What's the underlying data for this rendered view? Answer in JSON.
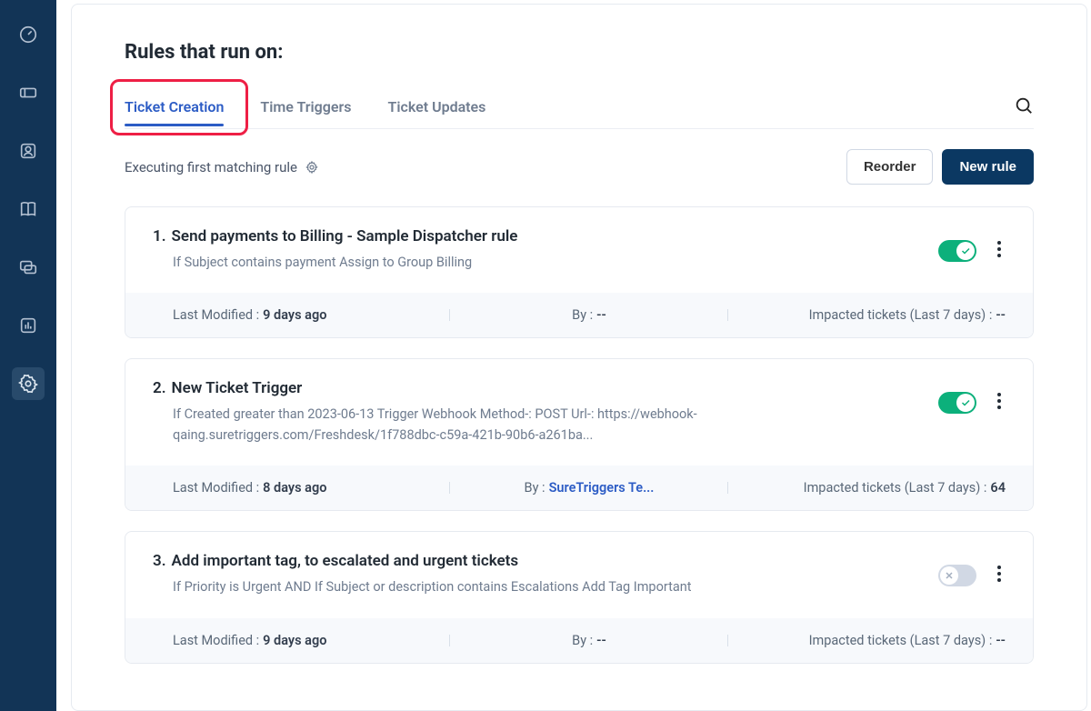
{
  "sidebar": {
    "items": [
      "dashboard",
      "tickets",
      "contacts",
      "solutions",
      "forums",
      "analytics",
      "settings"
    ],
    "active": "settings"
  },
  "header": {
    "title": "Rules that run on:"
  },
  "tabs": {
    "items": [
      "Ticket Creation",
      "Time Triggers",
      "Ticket Updates"
    ],
    "active_index": 0
  },
  "exec": {
    "label": "Executing first matching rule"
  },
  "actions": {
    "reorder": "Reorder",
    "new_rule": "New rule"
  },
  "footer_labels": {
    "last_modified": "Last Modified :",
    "by": "By :",
    "impacted": "Impacted tickets (Last 7 days) :"
  },
  "rules": [
    {
      "index": "1.",
      "title": "Send payments to Billing - Sample Dispatcher rule",
      "desc": "If Subject contains payment Assign to Group Billing",
      "enabled": true,
      "last_modified": "9 days ago",
      "by": "--",
      "by_link": false,
      "impacted": "--"
    },
    {
      "index": "2.",
      "title": "New Ticket Trigger",
      "desc": "If Created greater than 2023-06-13 Trigger Webhook Method-: POST Url-: https://webhook-qaing.suretriggers.com/Freshdesk/1f788dbc-c59a-421b-90b6-a261ba...",
      "enabled": true,
      "last_modified": "8 days ago",
      "by": "SureTriggers Te...",
      "by_link": true,
      "impacted": "64"
    },
    {
      "index": "3.",
      "title": "Add important tag, to escalated and urgent tickets",
      "desc": "If Priority is Urgent AND If Subject or description contains Escalations Add Tag Important",
      "enabled": false,
      "last_modified": "9 days ago",
      "by": "--",
      "by_link": false,
      "impacted": "--"
    }
  ]
}
